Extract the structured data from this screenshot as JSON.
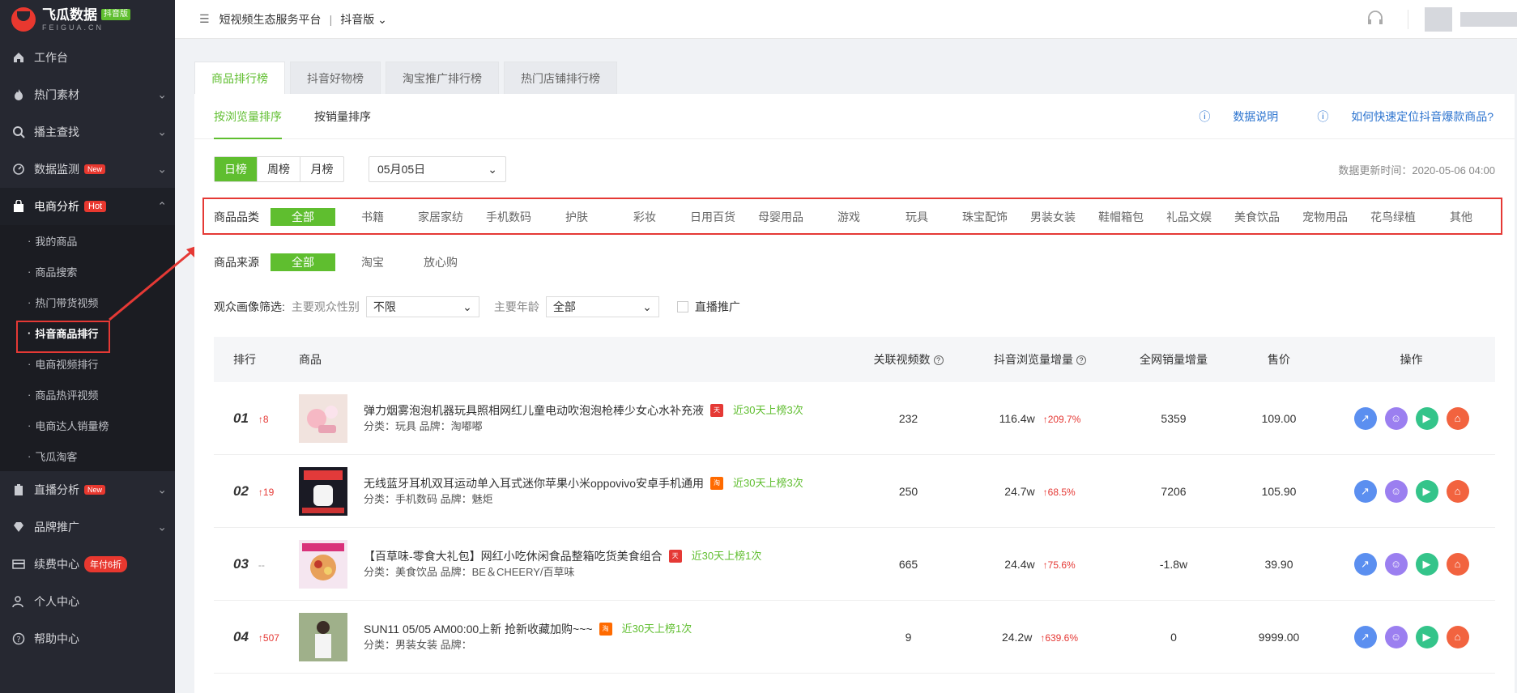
{
  "brand": {
    "title": "飞瓜数据",
    "badge": "抖音版",
    "sub": "FEIGUA.CN"
  },
  "topbar": {
    "platform": "短视频生态服务平台",
    "separator": "|",
    "version": "抖音版"
  },
  "sidebar": {
    "items": [
      {
        "label": "工作台"
      },
      {
        "label": "热门素材"
      },
      {
        "label": "播主查找"
      },
      {
        "label": "数据监测",
        "tag": "New"
      },
      {
        "label": "电商分析",
        "tag": "Hot"
      },
      {
        "label": "直播分析",
        "tag": "New"
      },
      {
        "label": "品牌推广"
      },
      {
        "label": "续费中心",
        "tag": "年付6折"
      },
      {
        "label": "个人中心"
      },
      {
        "label": "帮助中心"
      }
    ],
    "sub_items": [
      "我的商品",
      "商品搜索",
      "热门带货视频",
      "抖音商品排行",
      "电商视频排行",
      "商品热评视频",
      "电商达人销量榜",
      "飞瓜淘客"
    ]
  },
  "tabs": [
    "商品排行榜",
    "抖音好物榜",
    "淘宝推广排行榜",
    "热门店铺排行榜"
  ],
  "subtabs": [
    "按浏览量排序",
    "按销量排序"
  ],
  "help_links": {
    "data_note": "数据说明",
    "howto": "如何快速定位抖音爆款商品?"
  },
  "period": {
    "options": [
      "日榜",
      "周榜",
      "月榜"
    ],
    "date": "05月05日"
  },
  "update_time": "数据更新时间：2020-05-06 04:00",
  "category": {
    "label": "商品品类",
    "options": [
      "全部",
      "书籍",
      "家居家纺",
      "手机数码",
      "护肤",
      "彩妆",
      "日用百货",
      "母婴用品",
      "游戏",
      "玩具",
      "珠宝配饰",
      "男装女装",
      "鞋帽箱包",
      "礼品文娱",
      "美食饮品",
      "宠物用品",
      "花鸟绿植",
      "其他"
    ]
  },
  "source": {
    "label": "商品来源",
    "options": [
      "全部",
      "淘宝",
      "放心购"
    ]
  },
  "audience": {
    "label": "观众画像筛选:",
    "gender_label": "主要观众性别",
    "gender_value": "不限",
    "age_label": "主要年龄",
    "age_value": "全部",
    "live_label": "直播推广"
  },
  "table": {
    "headers": {
      "rank": "排行",
      "product": "商品",
      "videos": "关联视频数",
      "views": "抖音浏览量增量",
      "sales": "全网销量增量",
      "price": "售价",
      "ops": "操作"
    },
    "rows": [
      {
        "rank": "01",
        "change": "↑8",
        "title": "弹力烟雾泡泡机器玩具照相网红儿童电动吹泡泡枪棒少女心水补充液",
        "meta": "分类：玩具 品牌：淘嘟嘟",
        "src": "tmall",
        "onlist": "近30天上榜3次",
        "videos": "232",
        "views": "116.4w",
        "pct": "↑209.7%",
        "sales": "5359",
        "price": "109.00"
      },
      {
        "rank": "02",
        "change": "↑19",
        "title": "无线蓝牙耳机双耳运动单入耳式迷你苹果小米oppovivo安卓手机通用",
        "meta": "分类：手机数码 品牌：魅炬",
        "src": "taobao",
        "onlist": "近30天上榜3次",
        "videos": "250",
        "views": "24.7w",
        "pct": "↑68.5%",
        "sales": "7206",
        "price": "105.90"
      },
      {
        "rank": "03",
        "change": "--",
        "title": "【百草味-零食大礼包】网红小吃休闲食品整箱吃货美食组合",
        "meta": "分类：美食饮品 品牌：BE＆CHEERY/百草味",
        "src": "tmall",
        "onlist": "近30天上榜1次",
        "videos": "665",
        "views": "24.4w",
        "pct": "↑75.6%",
        "sales": "-1.8w",
        "price": "39.90"
      },
      {
        "rank": "04",
        "change": "↑507",
        "title": "SUN11 05/05 AM00:00上新 抢新收藏加购~~~",
        "meta": "分类：男装女装 品牌：",
        "src": "taobao",
        "onlist": "近30天上榜1次",
        "videos": "9",
        "views": "24.2w",
        "pct": "↑639.6%",
        "sales": "0",
        "price": "9999.00"
      }
    ]
  },
  "thumb_images": [
    "pink-bubble-toy",
    "earbuds-box",
    "snack-gift-box",
    "girl-photo"
  ],
  "colors": {
    "accent": "#5fbe2f",
    "brand_red": "#e8382f",
    "highlight": "#e53935",
    "sidebar_bg": "#262831"
  }
}
